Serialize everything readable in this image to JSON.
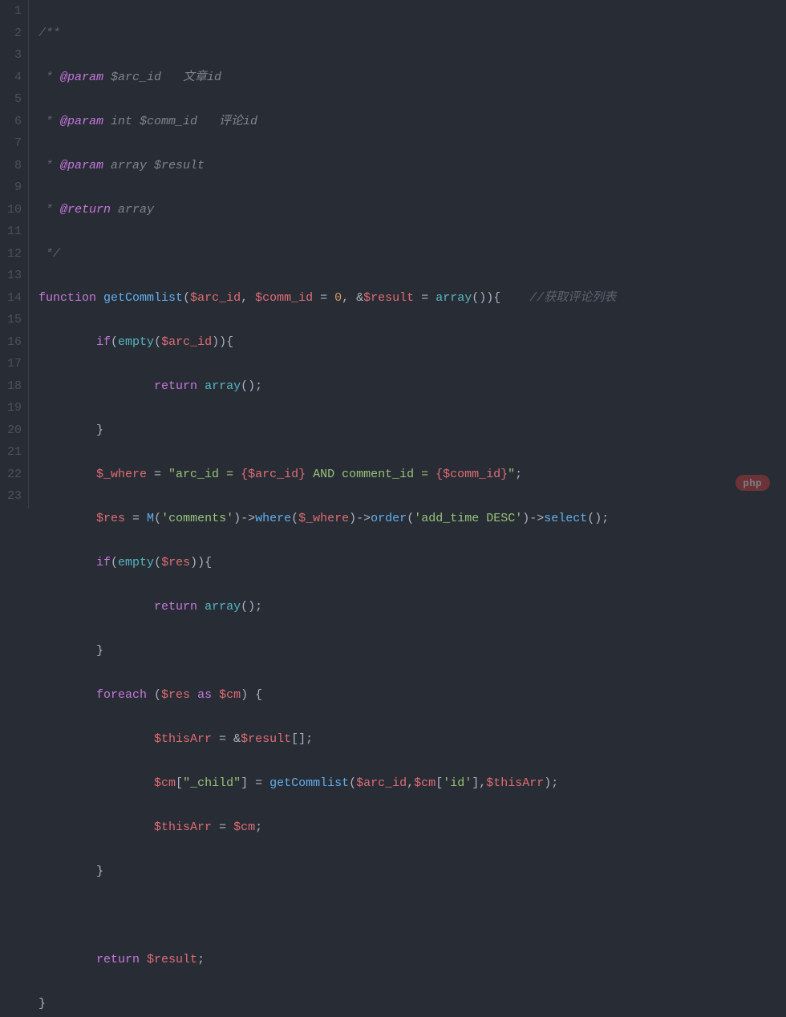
{
  "lineCount": 23,
  "tokens": {
    "l1": {
      "a": "/**"
    },
    "l2": {
      "a": " * ",
      "b": "@param",
      "c": " $arc_id   文章id"
    },
    "l3": {
      "a": " * ",
      "b": "@param",
      "c": " int $comm_id   评论id"
    },
    "l4": {
      "a": " * ",
      "b": "@param",
      "c": " array $result"
    },
    "l5": {
      "a": " * ",
      "b": "@return",
      "c": " array"
    },
    "l6": {
      "a": " */"
    },
    "l7": {
      "kw": "function",
      "fn": "getCommlist",
      "v1": "$arc_id",
      "v2": "$comm_id",
      "eq": " = ",
      "num": "0",
      "v3": "$result",
      "arrkw": "array",
      "brace": "()){",
      "cm": "//获取评论列表"
    },
    "l8": {
      "kw": "if",
      "fn": "empty",
      "v": "$arc_id",
      "tail": ")){"
    },
    "l9": {
      "kw": "return",
      "fn": "array",
      "tail": "();"
    },
    "l10": {
      "a": "}"
    },
    "l11": {
      "v": "$_where",
      "s1": "\"arc_id = ",
      "i1": "{$arc_id}",
      "s2": " AND comment_id = ",
      "i2": "{$comm_id}",
      "s3": "\"",
      "tail": ";"
    },
    "l12": {
      "v": "$res",
      "fn": "M",
      "s1": "'comments'",
      "m1": "where",
      "v2": "$_where",
      "m2": "order",
      "s2": "'add_time DESC'",
      "m3": "select",
      "tail": "();"
    },
    "l13": {
      "kw": "if",
      "fn": "empty",
      "v": "$res",
      "tail": ")){"
    },
    "l14": {
      "kw": "return",
      "fn": "array",
      "tail": "();"
    },
    "l15": {
      "a": "}"
    },
    "l16": {
      "kw": "foreach",
      "v1": "$res",
      "as": "as",
      "v2": "$cm",
      "tail": ") {"
    },
    "l17": {
      "v1": "$thisArr",
      "v2": "$result",
      "tail": "[];"
    },
    "l18": {
      "v1": "$cm",
      "s1": "\"_child\"",
      "fn": "getCommlist",
      "v2": "$arc_id",
      "v3": "$cm",
      "s2": "'id'",
      "v4": "$thisArr",
      "tail": ");"
    },
    "l19": {
      "v1": "$thisArr",
      "v2": "$cm",
      "tail": ";"
    },
    "l20": {
      "a": "}"
    },
    "l22": {
      "kw": "return",
      "v": "$result",
      "tail": ";"
    },
    "l23": {
      "a": "}"
    }
  },
  "watermark": "php"
}
